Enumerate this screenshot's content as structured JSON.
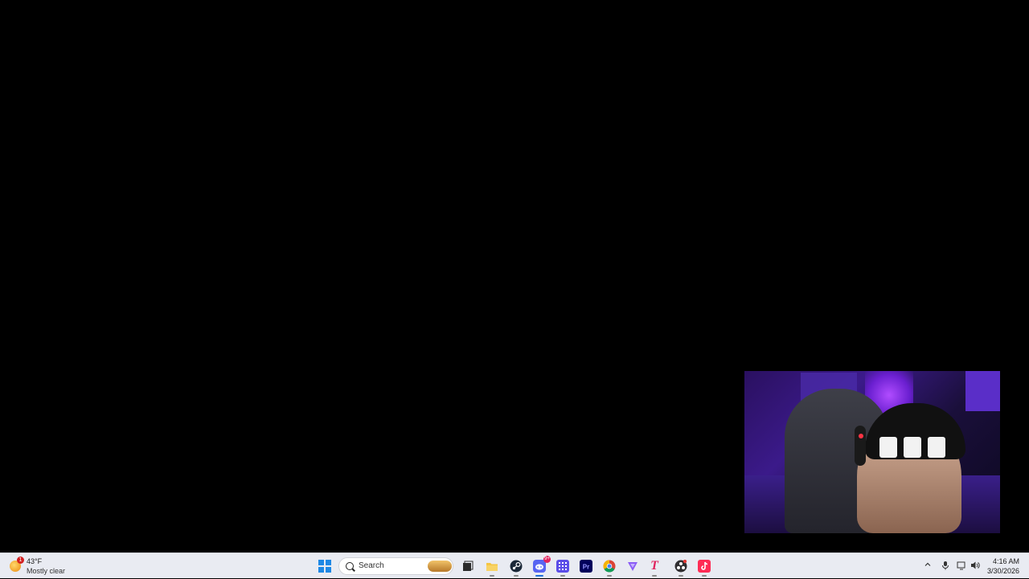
{
  "desktop": {
    "background": "#000000"
  },
  "webcam": {
    "label": "webcam overlay"
  },
  "taskbar": {
    "weather": {
      "badge": "1",
      "temperature": "43°F",
      "condition": "Mostly clear"
    },
    "search": {
      "label": "Search"
    },
    "apps": [
      {
        "name": "Start",
        "icon": "windows-start-icon"
      },
      {
        "name": "Task View",
        "icon": "task-view-icon"
      },
      {
        "name": "File Explorer",
        "icon": "folder-icon"
      },
      {
        "name": "Steam",
        "icon": "steam-icon"
      },
      {
        "name": "Discord",
        "icon": "discord-icon",
        "badge": "9+"
      },
      {
        "name": "App Grid",
        "icon": "grid-app-icon"
      },
      {
        "name": "Premiere Pro",
        "icon": "premiere-icon",
        "text": "Pr"
      },
      {
        "name": "Chrome",
        "icon": "chrome-icon"
      },
      {
        "name": "Vector App",
        "icon": "triangle-app-icon"
      },
      {
        "name": "T App",
        "icon": "t-app-icon",
        "text": "T"
      },
      {
        "name": "OBS",
        "icon": "obs-icon"
      },
      {
        "name": "TikTok",
        "icon": "tiktok-icon"
      }
    ],
    "tray": {
      "time": "4:16 AM",
      "date": "3/30/2026"
    },
    "colors": {
      "taskbar_bg": "#e9ebf2",
      "accent": "#1e6fd9"
    }
  }
}
